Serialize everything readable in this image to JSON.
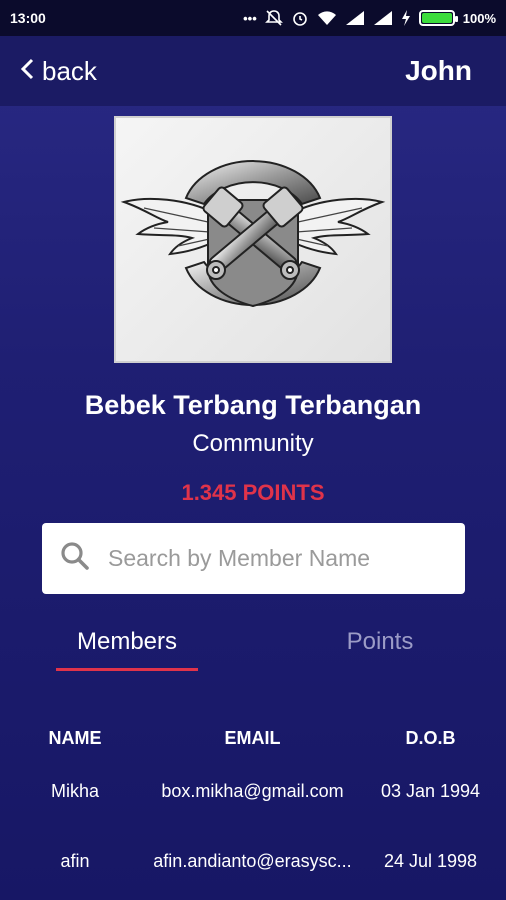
{
  "status_bar": {
    "time": "13:00",
    "icons": [
      "dots-icon",
      "mute-icon",
      "alarm-icon",
      "wifi-icon",
      "signal-icon",
      "signal-icon",
      "charging-icon",
      "battery-icon"
    ],
    "battery_percent": "100%",
    "battery_level": 1.0
  },
  "app_bar": {
    "back_label": "back",
    "user_name": "John"
  },
  "community": {
    "name": "Bebek Terbang Terbangan",
    "type": "Community",
    "points": "1.345 POINTS"
  },
  "search": {
    "placeholder": "Search by Member Name",
    "value": ""
  },
  "tabs": [
    {
      "label": "Members",
      "active": true
    },
    {
      "label": "Points",
      "active": false
    }
  ],
  "colors": {
    "accent": "#e0334a",
    "background": "#1f1f73",
    "inactive_tab": "#9c9cc7"
  },
  "table": {
    "headers": [
      "NAME",
      "EMAIL",
      "D.O.B"
    ],
    "rows": [
      {
        "name": "Mikha",
        "email": "box.mikha@gmail.com",
        "dob": "03 Jan 1994"
      },
      {
        "name": "afin",
        "email": "afin.andianto@erasysc...",
        "dob": "24 Jul 1998"
      }
    ]
  }
}
